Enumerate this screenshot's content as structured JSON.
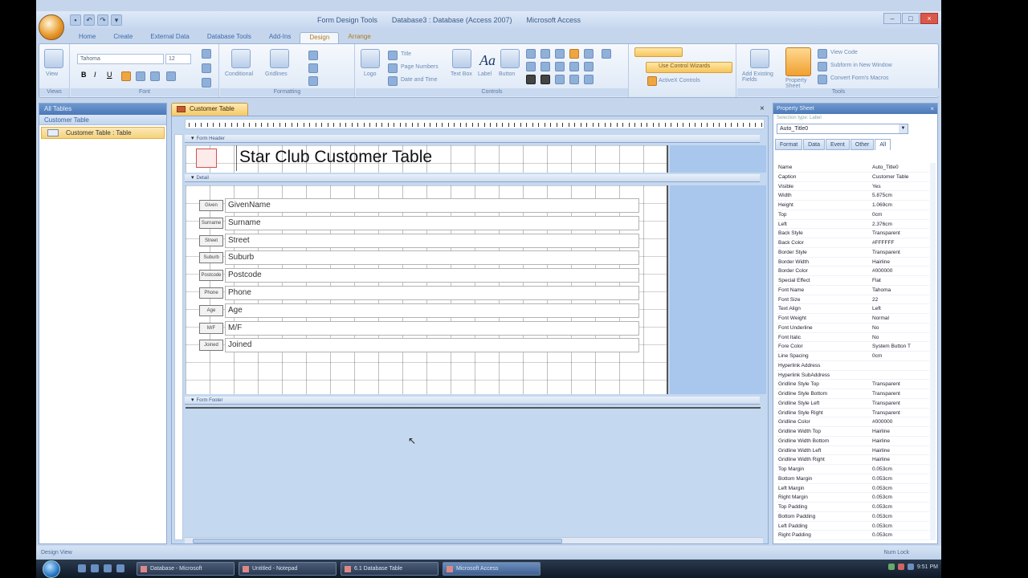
{
  "app": {
    "title_parts": [
      "Form Design Tools",
      "Database3 : Database (Access 2007)",
      "Microsoft Access"
    ]
  },
  "quick_access": [
    "save-icon",
    "undo-icon",
    "redo-icon",
    "dropdown-icon"
  ],
  "ribbon_tabs": [
    {
      "label": "Home",
      "active": false
    },
    {
      "label": "Create",
      "active": false
    },
    {
      "label": "External Data",
      "active": false
    },
    {
      "label": "Database Tools",
      "active": false
    },
    {
      "label": "Add-Ins",
      "active": false
    },
    {
      "label": "Design",
      "active": true
    },
    {
      "label": "Arrange",
      "active": false
    }
  ],
  "ribbon": {
    "views_label": "Views",
    "view_button": "View",
    "font_name": "Tahoma",
    "font_size": "12",
    "font_group": "Font",
    "gridlines_label": "Gridlines",
    "conditional_label": "Conditional",
    "formatting_group": "Formatting",
    "title_btn": "Title",
    "page_numbers_btn": "Page Numbers",
    "date_time_btn": "Date and Time",
    "logo_btn": "Logo",
    "textbox_btn": "Text Box",
    "label_btn": "Label",
    "button_btn": "Button",
    "controls_group": "Controls",
    "use_wizards": "Use Control Wizards",
    "activex": "ActiveX Controls",
    "add_existing": "Add Existing Fields",
    "property_sheet": "Property Sheet",
    "view_code": "View Code",
    "subform": "Subform in New Window",
    "convert_macros": "Convert Form's Macros",
    "tools_group": "Tools"
  },
  "nav_pane": {
    "header": "All Tables",
    "group": "Customer Table",
    "item": "Customer Table : Table"
  },
  "document": {
    "tab_label": "Customer Table",
    "close_glyph": "×",
    "form_header_label": "Form Header",
    "detail_label": "Detail",
    "form_footer_label": "Form Footer",
    "title_text": "Star Club Customer Table",
    "fields": [
      {
        "label": "Given",
        "value": "GivenName"
      },
      {
        "label": "Surname",
        "value": "Surname"
      },
      {
        "label": "Street",
        "value": "Street"
      },
      {
        "label": "Suburb",
        "value": "Suburb"
      },
      {
        "label": "Postcode",
        "value": "Postcode"
      },
      {
        "label": "Phone",
        "value": "Phone"
      },
      {
        "label": "Age",
        "value": "Age"
      },
      {
        "label": "M/F",
        "value": "M/F"
      },
      {
        "label": "Joined",
        "value": "Joined"
      }
    ]
  },
  "property_sheet": {
    "title": "Property Sheet",
    "close_glyph": "×",
    "selection_type": "Selection type: Label",
    "selected_control": "Auto_Title0",
    "tabs": [
      "Format",
      "Data",
      "Event",
      "Other",
      "All"
    ],
    "active_tab": "All",
    "rows": [
      [
        "Name",
        "Auto_Title0"
      ],
      [
        "Caption",
        "Customer Table"
      ],
      [
        "Visible",
        "Yes"
      ],
      [
        "Width",
        "5.875cm"
      ],
      [
        "Height",
        "1.069cm"
      ],
      [
        "Top",
        "0cm"
      ],
      [
        "Left",
        "2.376cm"
      ],
      [
        "Back Style",
        "Transparent"
      ],
      [
        "Back Color",
        "#FFFFFF"
      ],
      [
        "Border Style",
        "Transparent"
      ],
      [
        "Border Width",
        "Hairline"
      ],
      [
        "Border Color",
        "#000000"
      ],
      [
        "Special Effect",
        "Flat"
      ],
      [
        "Font Name",
        "Tahoma"
      ],
      [
        "Font Size",
        "22"
      ],
      [
        "Text Align",
        "Left"
      ],
      [
        "Font Weight",
        "Normal"
      ],
      [
        "Font Underline",
        "No"
      ],
      [
        "Font Italic",
        "No"
      ],
      [
        "Fore Color",
        "System Button T"
      ],
      [
        "Line Spacing",
        "0cm"
      ],
      [
        "Hyperlink Address",
        ""
      ],
      [
        "Hyperlink SubAddress",
        ""
      ],
      [
        "Gridline Style Top",
        "Transparent"
      ],
      [
        "Gridline Style Bottom",
        "Transparent"
      ],
      [
        "Gridline Style Left",
        "Transparent"
      ],
      [
        "Gridline Style Right",
        "Transparent"
      ],
      [
        "Gridline Color",
        "#000000"
      ],
      [
        "Gridline Width Top",
        "Hairline"
      ],
      [
        "Gridline Width Bottom",
        "Hairline"
      ],
      [
        "Gridline Width Left",
        "Hairline"
      ],
      [
        "Gridline Width Right",
        "Hairline"
      ],
      [
        "Top Margin",
        "0.053cm"
      ],
      [
        "Bottom Margin",
        "0.053cm"
      ],
      [
        "Left Margin",
        "0.053cm"
      ],
      [
        "Right Margin",
        "0.053cm"
      ],
      [
        "Top Padding",
        "0.053cm"
      ],
      [
        "Bottom Padding",
        "0.053cm"
      ],
      [
        "Left Padding",
        "0.053cm"
      ],
      [
        "Right Padding",
        "0.053cm"
      ]
    ]
  },
  "status": {
    "left": "Design View",
    "right": "Num Lock"
  },
  "taskbar": {
    "tasks": [
      {
        "label": "Database - Microsoft",
        "active": false
      },
      {
        "label": "Untitled - Notepad",
        "active": false
      },
      {
        "label": "6.1 Database Table",
        "active": false
      },
      {
        "label": "Microsoft Access",
        "active": true
      }
    ],
    "clock": "9:51 PM"
  }
}
